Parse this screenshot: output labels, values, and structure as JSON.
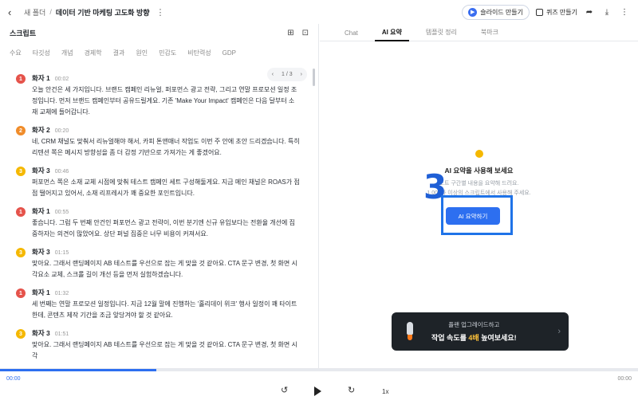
{
  "header": {
    "folder": "새 폴더",
    "separator": "/",
    "title": "데이터 기반 마케팅 고도화 방향",
    "slide_button": "슬라이드 만들기",
    "quiz_button": "퀴즈 만들기"
  },
  "script": {
    "title": "스크립트",
    "keywords": [
      "수요",
      "타깃성",
      "개념",
      "경제학",
      "결과",
      "원인",
      "민감도",
      "비탄력성",
      "GDP"
    ],
    "pager": "1 / 3",
    "turns": [
      {
        "num": "1",
        "color": "#e5534b",
        "speaker": "화자 1",
        "time": "00:02",
        "text": "오늘 안건은 세 가지입니다. 브랜드 캠페인 리뉴얼, 퍼포먼스 광고 전략, 그리고 연말 프로모션 일정 조정입니다. 먼저 브랜드 캠페인부터 공유드릴게요. 기존 'Make Your Impact' 캠페인은 다음 달부터 소재 교체에 들어갑니다."
      },
      {
        "num": "2",
        "color": "#f08c2a",
        "speaker": "화자 2",
        "time": "00:20",
        "text": "네, CRM 채널도 맞춰서 리뉴얼해야 해서, 카피 톤앤매너 작업도 이번 주 안에 초안 드리겠습니다. 특히 리텐션 쪽은 메시지 방향성을 좀 더 감정 기반으로 가져가는 게 좋겠어요."
      },
      {
        "num": "3",
        "color": "#f5b800",
        "speaker": "화자 3",
        "time": "00:46",
        "text": "퍼포먼스 쪽은 소재 교체 시점에 맞춰 테스트 캠페인 세트 구성해둘게요. 지금 메인 채널은 ROAS가 점점 떨어지고 있어서, 소재 리프레시가 꽤 중요한 포인트입니다."
      },
      {
        "num": "1",
        "color": "#e5534b",
        "speaker": "화자 1",
        "time": "00:55",
        "text": "좋습니다. 그럼 두 번째 안건인 퍼포먼스 광고 전략이, 이번 분기엔 신규 유입보다는 전환율 개선에 집중하자는 의견이 많았어요. 상단 퍼널 집중은 너무 비용이 커져서요."
      },
      {
        "num": "3",
        "color": "#f5b800",
        "speaker": "화자 3",
        "time": "01:15",
        "text": "맞아요. 그래서 랜딩페이지 AB 테스트를 우선으로 잡는 게 맞을 것 같아요. CTA 문구 변경, 첫 화면 시각요소 교체, 스크롤 길이 개선 등을 먼저 실험하겠습니다."
      },
      {
        "num": "1",
        "color": "#e5534b",
        "speaker": "화자 1",
        "time": "01:32",
        "text": "세 번째는 연말 프로모션 일정입니다. 지금 12월 말에 진행하는 '홀리데이 위크' 행사 일정이 꽤 타이트한데, 콘텐츠 제작 기간을 조금 앞당겨야 할 것 같아요."
      },
      {
        "num": "3",
        "color": "#f5b800",
        "speaker": "화자 3",
        "time": "01:51",
        "text": "맞아요. 그래서 랜딩페이지 AB 테스트를 우선으로 잡는 게 맞을 것 같아요. CTA 문구 변경, 첫 화면 시각"
      }
    ]
  },
  "panel": {
    "tabs": [
      "Chat",
      "AI 요약",
      "템플릿 정리",
      "북마크"
    ],
    "active_tab": "AI 요약",
    "ai_title": "AI 요약을 사용해 보세요",
    "ai_desc_1": "노트 구간별 내용을 요약해 드려요.",
    "ai_desc_2": "1,000자 이상의 스크립트에서 사용해 주세요.",
    "ai_button": "AI 요약하기",
    "annotation": "3",
    "upgrade_line1": "플랜 업그레이드하고",
    "upgrade_pre": "작업 속도를 ",
    "upgrade_highlight": "4배",
    "upgrade_post": " 높여보세요!"
  },
  "player": {
    "current": "00:00",
    "total": "00:00",
    "speed": "1x",
    "progress": 0.245
  }
}
